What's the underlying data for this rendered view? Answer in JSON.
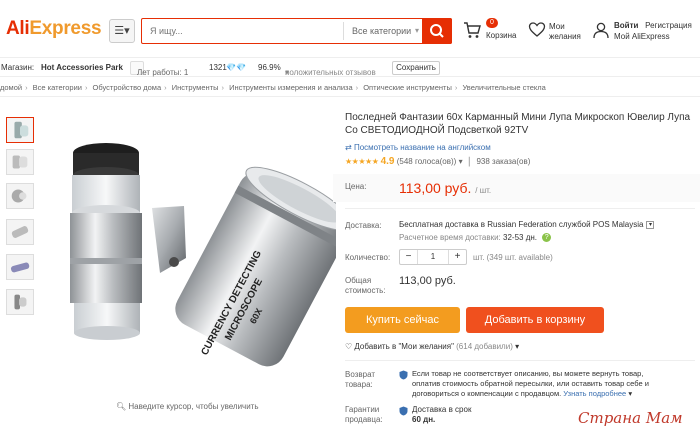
{
  "header": {
    "logo_main": "Ali",
    "logo_ex": "Express",
    "search_placeholder": "Я ищу...",
    "search_category": "Все категории",
    "cart_count": "0",
    "cart_label": "Корзина",
    "wish_label_1": "Мои",
    "wish_label_2": "желания",
    "login": "Войти",
    "register": "Регистрация",
    "my_account": "Мой AliExpress"
  },
  "store": {
    "label": "Магазин:",
    "name": "Hot Accessories Park",
    "years": "Лет работы: 1",
    "score": "1321",
    "positive_pct": "96.9%",
    "positive_label": "положительных отзывов",
    "save": "Сохранить"
  },
  "breadcrumbs": [
    "домой",
    "Все категории",
    "Обустройство дома",
    "Инструменты",
    "Инструменты измерения и анализа",
    "Оптические инструменты",
    "Увеличительные стекла"
  ],
  "product": {
    "title": "Последней Фантазии 60x Карманный Мини Лупа Микроскоп Ювелир Лупа Со СВЕТОДИОДНОЙ Подсветкой 92TV",
    "translate_link": "Посмотреть название на английском",
    "stars": "★★★★★",
    "rating": "4.9",
    "votes": "(548 голоса(ов))",
    "orders": "938 заказа(ов)",
    "price_label": "Цена:",
    "price": "113,00 руб.",
    "price_unit": "/ шт.",
    "shipping_label": "Доставка:",
    "shipping_text": "Бесплатная доставка в Russian Federation службой POS Malaysia",
    "eta_label": "Расчетное время доставки:",
    "eta_value": "32-53 дн.",
    "quantity_label": "Количество:",
    "quantity": "1",
    "available": "шт. (349 шт. available)",
    "total_label_1": "Общая",
    "total_label_2": "стоимость:",
    "total": "113,00 руб.",
    "buy_now": "Купить сейчас",
    "add_to_cart": "Добавить в корзину",
    "add_to_wish": "Добавить в \"Мои желания\"",
    "wish_count": "(614 добавили)",
    "returns_label_1": "Возврат",
    "returns_label_2": "товара:",
    "returns_text_1": "Если товар не соответствует описанию, вы можете вернуть товар,",
    "returns_text_2": "оплатив стоимость обратной пересылки, или оставить товар себе и",
    "returns_text_3": "договориться о компенсации с продавцом.",
    "returns_more": "Узнать подробнее",
    "guarantee_label_1": "Гарантии",
    "guarantee_label_2": "продавца:",
    "guarantee_text_1": "Доставка в срок",
    "guarantee_text_2": "60 дн.",
    "zoom_hint": "Наведите курсор, чтобы увеличить"
  },
  "image_text": {
    "line1": "CURRENCY DETECTING",
    "line2": "MICROSCOPE",
    "line3": "60X"
  },
  "watermark": "Страна Мам",
  "colors": {
    "accent": "#e62e04",
    "buy": "#f39c1f",
    "cart": "#f0501e",
    "link": "#3a6fb0",
    "star": "#f5a623"
  }
}
